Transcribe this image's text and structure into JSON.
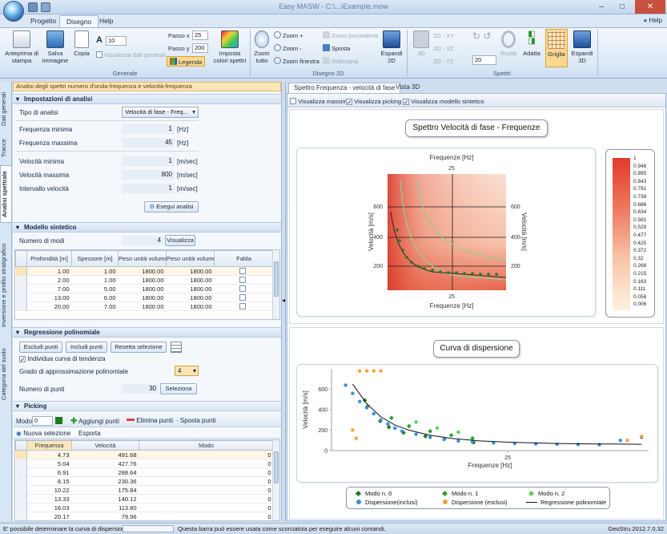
{
  "window": {
    "title": "Easy MASW - C:\\...\\Example.mow",
    "help_label": "Help"
  },
  "tabs": [
    "Progetto",
    "Disegno",
    "Help"
  ],
  "ribbon": {
    "generale": {
      "label": "Generale",
      "anteprima": "Anteprima di stampa",
      "salva": "Salva immagine",
      "copia": "Copia",
      "font_size": "10",
      "visualizza_dati": "Visualizza dati generali",
      "passo_x_label": "Passo x",
      "passo_x": "25",
      "passo_y_label": "Passo y",
      "passo_y": "200",
      "legenda": "Legenda",
      "imposta_colori": "Imposta colori spettri"
    },
    "disegno2d": {
      "label": "Disegno 2D",
      "zoom_tutto": "Zoom tutto",
      "zoom_plus": "Zoom +",
      "zoom_minus": "Zoom -",
      "zoom_finestra": "Zoom finestra",
      "zoom_precedente": "Zoom precedente",
      "sposta": "Sposta",
      "ridisegna": "Ridisegna",
      "espandi2d": "Espandi 2D"
    },
    "spettri": {
      "label": "Spettri",
      "b3d": "3D",
      "xy": "2D - XY",
      "xz": "2D - XZ",
      "yz": "2D - YZ",
      "angle": "20",
      "ruota": "Ruota",
      "adatta": "Adatta",
      "griglia": "Griglia",
      "espandi3d": "Espandi 3D"
    }
  },
  "vtabs": [
    "Dati generali",
    "Tracce",
    "Analisi spettrale",
    "Inversione e profilo stratigrafico",
    "Categoria del suolo"
  ],
  "panel_header": "Analisi degli spettri numero d'onda-frequenza e velocità-frequenza",
  "impostazioni": {
    "title": "Impostazioni di analisi",
    "tipo_label": "Tipo di analisi",
    "tipo_value": "Velocità di fase - Freq...",
    "rows": [
      {
        "label": "Frequenza minima",
        "value": "1",
        "unit": "[Hz]"
      },
      {
        "label": "Frequenza massima",
        "value": "45",
        "unit": "[Hz]"
      },
      {
        "label": "Velocità minima",
        "value": "1",
        "unit": "[m/sec]"
      },
      {
        "label": "Velocità massima",
        "value": "800",
        "unit": "[m/sec]"
      },
      {
        "label": "Intervallo velocità",
        "value": "1",
        "unit": "[m/sec]"
      }
    ],
    "esegui": "Esegui analisi"
  },
  "modello": {
    "title": "Modello sintetico",
    "numero_label": "Numero di modi",
    "numero_value": "4",
    "visualizza": "Visualizza",
    "headers": [
      "Profondità [m]",
      "Spessore [m]",
      "Peso unità volume [Kg/mc]",
      "Peso unità volume sat [Kg/mc]",
      "Falda"
    ],
    "rows": [
      [
        "1.00",
        "1.00",
        "1800.00",
        "1800.00"
      ],
      [
        "2.00",
        "1.00",
        "1800.00",
        "1800.00"
      ],
      [
        "7.00",
        "5.00",
        "1800.00",
        "1800.00"
      ],
      [
        "13.00",
        "6.00",
        "1800.00",
        "1800.00"
      ],
      [
        "20.00",
        "7.00",
        "1800.00",
        "1800.00"
      ]
    ]
  },
  "regressione": {
    "title": "Regressione polinomiale",
    "escludi": "Escludi punti",
    "includi": "Includi punti",
    "resetta": "Resetta selezione",
    "individua": "Individua curva di tendenza",
    "grado_label": "Grado di approssimazione polinomiale",
    "grado_value": "4",
    "npunti_label": "Numero di punti",
    "npunti_value": "30",
    "seleziona": "Seleziona"
  },
  "picking": {
    "title": "Picking",
    "modo_label": "Modo",
    "modo_value": "0",
    "aggiungi": "Aggiungi punti",
    "elimina": "Elimina punti",
    "sposta": "Sposta punti",
    "nuova": "Nuova selezione",
    "esporta": "Esporta",
    "headers": [
      "Frequenza",
      "Velocità",
      "Modo"
    ],
    "rows": [
      [
        "4.73",
        "491.68",
        "0"
      ],
      [
        "5.04",
        "427.76",
        "0"
      ],
      [
        "6.91",
        "288.64",
        "0"
      ],
      [
        "8.15",
        "230.36",
        "0"
      ],
      [
        "10.22",
        "175.84",
        "0"
      ],
      [
        "13.33",
        "140.12",
        "0"
      ],
      [
        "16.03",
        "113.80",
        "0"
      ],
      [
        "20.17",
        "79.96",
        "0"
      ]
    ]
  },
  "right_tabs": [
    "Spettro Frequenza - velocità di fase",
    "Vista 3D"
  ],
  "checks": [
    "Visualizza massimi",
    "Visualizza picking",
    "Visualizza modello sintetico"
  ],
  "chart1": {
    "title": "Spettro Velocità di fase - Frequenze",
    "xlabel_top": "Frequenze [Hz]",
    "xlabel_bottom": "Frequenze [Hz]",
    "ylabel_left": "Velocità [m/s]",
    "ylabel_right": "Velocità [m/s]",
    "x_tick": "25",
    "y_ticks": [
      "600",
      "400",
      "200"
    ],
    "scale": [
      "1",
      "0.948",
      "0.895",
      "0.843",
      "0.791",
      "0.738",
      "0.686",
      "0.634",
      "0.581",
      "0.529",
      "0.477",
      "0.425",
      "0.372",
      "0.32",
      "0.268",
      "0.215",
      "0.163",
      "0.111",
      "0.058",
      "0.006"
    ]
  },
  "chart_data": {
    "type": "scatter",
    "title": "Curva di dispersione",
    "xlabel": "Frequenze [Hz]",
    "ylabel": "Velocità [m/s]",
    "ylim": [
      0,
      800
    ],
    "xlim": [
      0,
      45
    ],
    "x_ticks": [
      "25"
    ],
    "y_ticks": [
      "600",
      "400",
      "200",
      "0"
    ],
    "series": [
      {
        "name": "Modo n. 0",
        "color": "#1f7a1f",
        "x": [
          4.73,
          5.04,
          6.91,
          8.15,
          10.22,
          13.33,
          16.03,
          20.17
        ],
        "y": [
          491.68,
          427.76,
          288.64,
          230.36,
          175.84,
          140.12,
          113.8,
          79.96
        ]
      },
      {
        "name": "Modo n. 1",
        "color": "#2aa02a",
        "x": [
          8.5,
          11,
          14,
          17,
          20
        ],
        "y": [
          320,
          240,
          190,
          150,
          120
        ]
      },
      {
        "name": "Modo n. 2",
        "color": "#5bd35b",
        "x": [
          12,
          15,
          18
        ],
        "y": [
          280,
          220,
          180
        ]
      },
      {
        "name": "Dispersione(inclusi)",
        "color": "#3a8fe0",
        "x": [
          2,
          3,
          4,
          5,
          6,
          7,
          8,
          9,
          10,
          12,
          14,
          16,
          18,
          20,
          23,
          26,
          29,
          32,
          35,
          38,
          41,
          44
        ],
        "y": [
          640,
          560,
          480,
          420,
          360,
          300,
          260,
          220,
          190,
          160,
          130,
          110,
          95,
          85,
          75,
          70,
          66,
          62,
          60,
          58,
          100,
          130
        ]
      },
      {
        "name": "Dispersione (esclusi)",
        "color": "#f2a23a",
        "x": [
          4,
          5,
          6,
          7,
          3,
          3.5,
          42,
          44
        ],
        "y": [
          780,
          780,
          780,
          780,
          200,
          120,
          100,
          140
        ]
      },
      {
        "name": "Regressione polinomiale",
        "color": "#111111",
        "x": [
          3,
          5,
          7,
          9,
          11,
          14,
          17,
          21,
          26,
          32,
          38,
          44
        ],
        "y": [
          650,
          460,
          330,
          250,
          200,
          150,
          120,
          95,
          80,
          70,
          65,
          62
        ]
      }
    ],
    "legend": [
      "Modo n. 0",
      "Modo n. 1",
      "Modo n. 2",
      "Dispersione(inclusi)",
      "Dispersione (esclusi)",
      "Regressione polinomiale"
    ]
  },
  "status": {
    "left": "E' possibile determinare la curva di dispersione.",
    "middle": "Questa barra può essere usata come scorciatoia per eseguire alcuni comandi.",
    "right": "GeoStru 2012.7.0.32"
  }
}
